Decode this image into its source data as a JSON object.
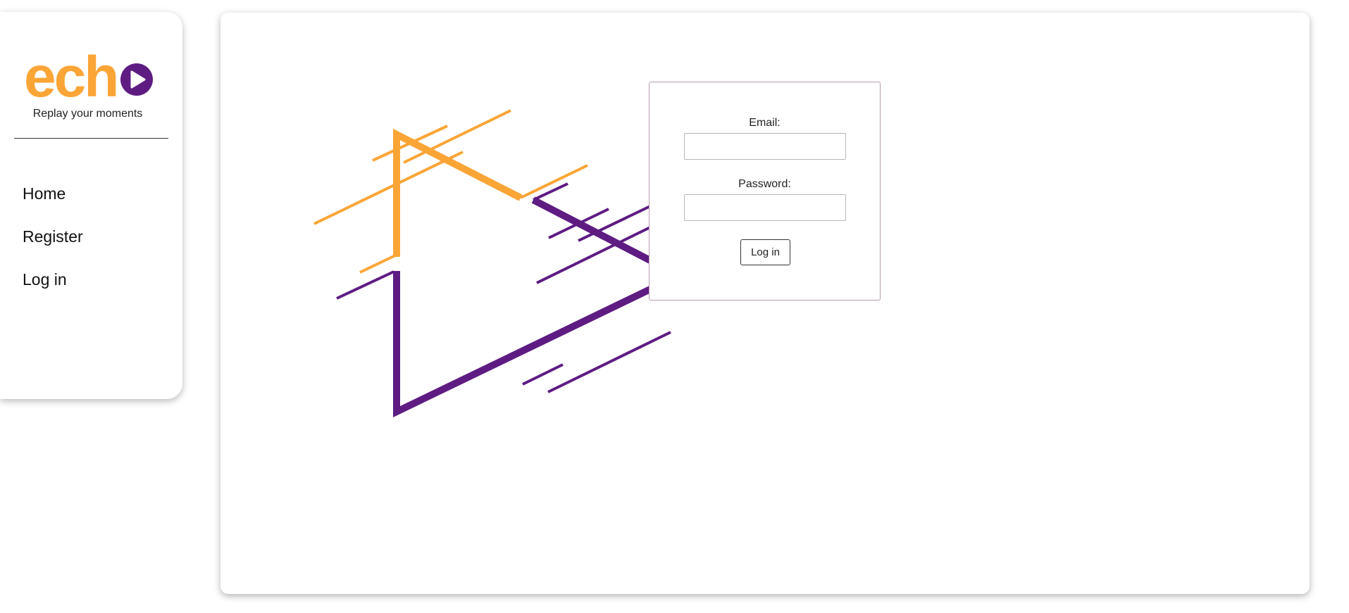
{
  "colors": {
    "brand_orange": "#FBA537",
    "brand_purple": "#5E1C83",
    "card_border": "#B89AAF"
  },
  "sidebar": {
    "logo": {
      "wordmark": "ech",
      "icon": "play-circle-icon"
    },
    "tagline": "Replay your moments",
    "nav": [
      {
        "label": "Home"
      },
      {
        "label": "Register"
      },
      {
        "label": "Log in"
      }
    ]
  },
  "main": {
    "illustration": "play-triangle-icon",
    "login_form": {
      "email_label": "Email:",
      "email_value": "",
      "password_label": "Password:",
      "password_value": "",
      "submit_label": "Log in"
    }
  }
}
